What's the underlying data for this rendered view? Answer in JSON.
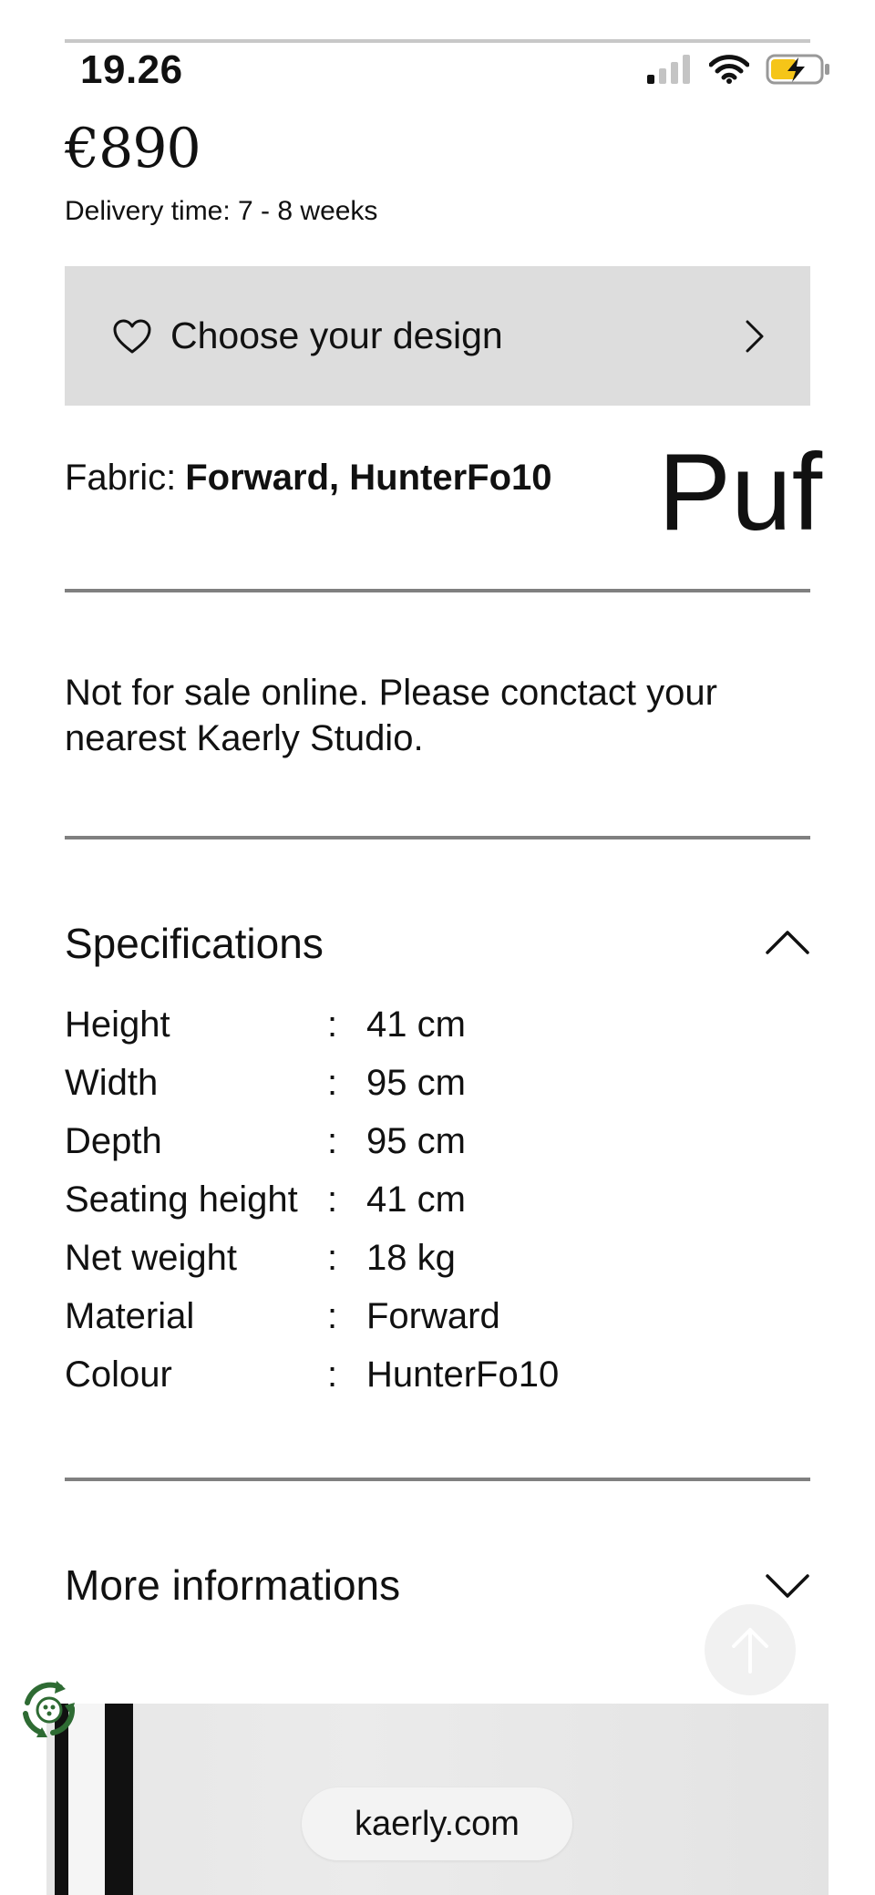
{
  "status_bar": {
    "time": "19.26"
  },
  "product": {
    "price": "€890",
    "delivery": "Delivery time: 7 - 8 weeks",
    "design_button_label": "Choose your design",
    "fabric_label": "Fabric:",
    "fabric_value": "Forward, HunterFo10",
    "title_fragment": "Puf",
    "notice": "Not for sale online. Please conctact your nearest Kaerly Studio."
  },
  "specifications": {
    "title": "Specifications",
    "rows": [
      {
        "label": "Height",
        "value": "41 cm"
      },
      {
        "label": "Width",
        "value": "95 cm"
      },
      {
        "label": "Depth",
        "value": "95 cm"
      },
      {
        "label": "Seating height",
        "value": "41 cm"
      },
      {
        "label": "Net weight",
        "value": "18 kg"
      },
      {
        "label": "Material",
        "value": "Forward"
      },
      {
        "label": "Colour",
        "value": "HunterFo10"
      }
    ]
  },
  "more_info": {
    "title": "More informations"
  },
  "browser": {
    "url": "kaerly.com"
  },
  "colors": {
    "button_bg": "#dddddd",
    "rule": "#808080",
    "recycle_green": "#2e6b33",
    "battery_yellow": "#f5c518"
  }
}
